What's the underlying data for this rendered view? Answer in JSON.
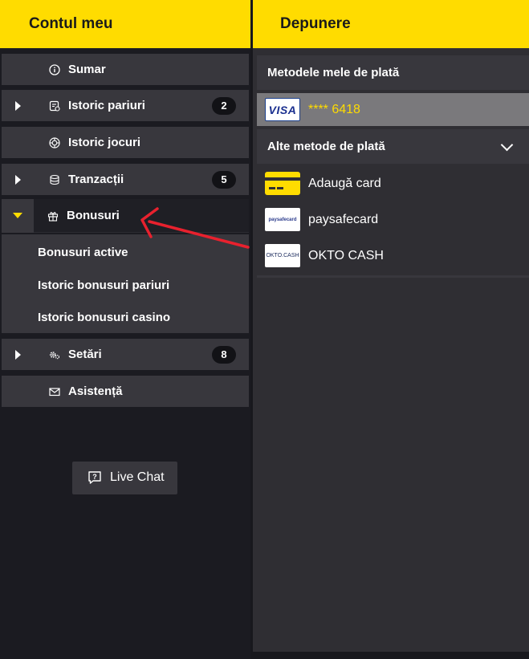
{
  "left_panel": {
    "title": "Contul meu",
    "menu": {
      "summary": "Sumar",
      "bet_history": "Istoric pariuri",
      "bet_history_count": "2",
      "game_history": "Istoric jocuri",
      "transactions": "Tranzacții",
      "transactions_count": "5",
      "bonuses": "Bonusuri",
      "bonus_sub": [
        "Bonusuri active",
        "Istoric bonusuri pariuri",
        "Istoric bonusuri casino"
      ],
      "settings": "Setări",
      "settings_count": "8",
      "support": "Asistență"
    },
    "live_chat": "Live Chat"
  },
  "right_panel": {
    "title": "Depunere",
    "my_methods_title": "Metodele mele de plată",
    "saved_card": {
      "logo_text": "VISA",
      "number": "**** 6418"
    },
    "other_methods_title": "Alte metode de plată",
    "methods": {
      "add_card": "Adaugă card",
      "paysafecard": "paysafecard",
      "paysafecard_logo": "paysafecard",
      "okto": "OKTO CASH",
      "okto_logo": "OKTO.CASH"
    }
  },
  "colors": {
    "brand_yellow": "#ffdc00",
    "panel_bg": "#2f2e33",
    "item_bg": "#38373d",
    "selected_bg": "#7a797c",
    "badge_bg": "#121216",
    "annotation_arrow": "#e8212e"
  }
}
